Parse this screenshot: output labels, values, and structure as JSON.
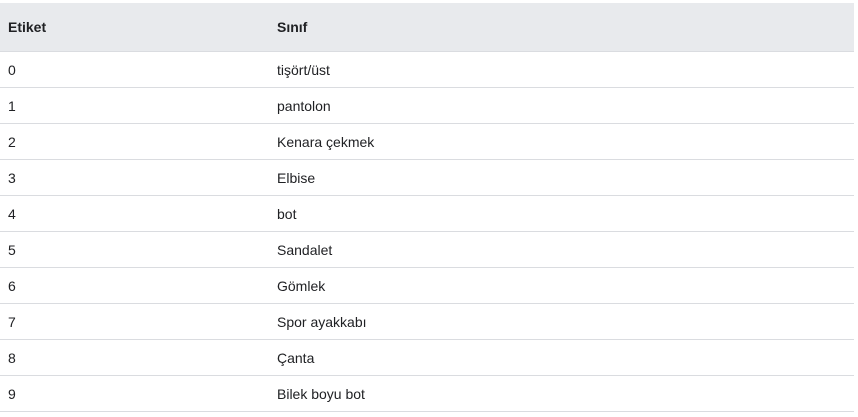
{
  "table": {
    "headers": [
      "Etiket",
      "Sınıf"
    ],
    "rows": [
      [
        "0",
        "tişört/üst"
      ],
      [
        "1",
        "pantolon"
      ],
      [
        "2",
        "Kenara çekmek"
      ],
      [
        "3",
        "Elbise"
      ],
      [
        "4",
        "bot"
      ],
      [
        "5",
        "Sandalet"
      ],
      [
        "6",
        "Gömlek"
      ],
      [
        "7",
        "Spor ayakkabı"
      ],
      [
        "8",
        "Çanta"
      ],
      [
        "9",
        "Bilek boyu bot"
      ]
    ]
  },
  "colors": {
    "header_background": "#e8eaed",
    "row_divider": "#dadce0",
    "text": "#202124"
  }
}
